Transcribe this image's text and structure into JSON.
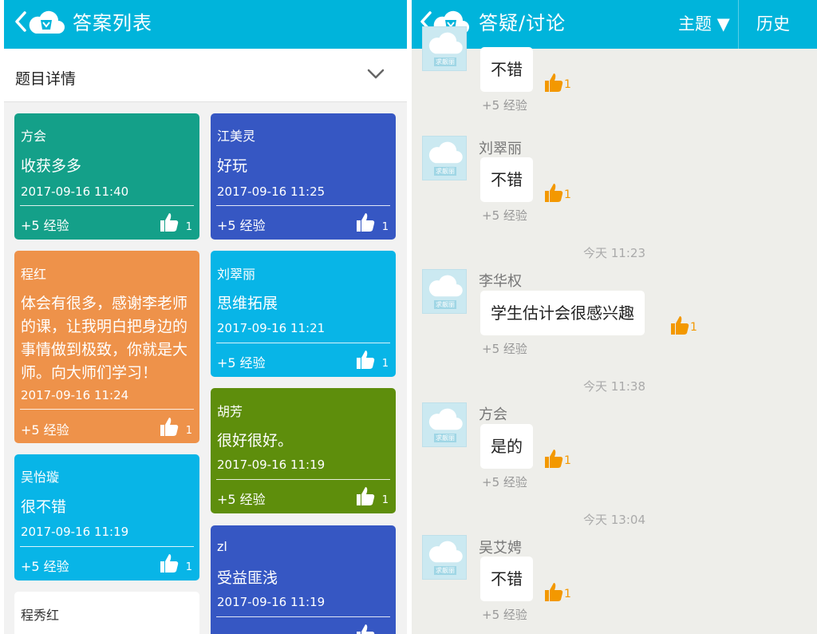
{
  "colors": {
    "header": "#00b4db",
    "accent_like": "#f39800"
  },
  "left_panel": {
    "title": "答案列表",
    "detail_label": "题目详情",
    "cards": [
      {
        "name": "方会",
        "content": "收获多多",
        "time": "2017-09-16 11:40",
        "exp": "+5 经验",
        "likes": "1",
        "color": "#14a089"
      },
      {
        "name": "程红",
        "content": "体会有很多，感谢李老师的课，让我明白把身边的事情做到极致，你就是大师。向大师们学习！",
        "time": "2017-09-16 11:24",
        "exp": "+5 经验",
        "likes": "1",
        "color": "#ee924a"
      },
      {
        "name": "吴怡璇",
        "content": "很不错",
        "time": "2017-09-16 11:19",
        "exp": "+5 经验",
        "likes": "1",
        "color": "#08b5e7"
      },
      {
        "name": "程秀红",
        "content": "",
        "time": "",
        "exp": "",
        "likes": "",
        "color": "#ffffff"
      },
      {
        "name": "江美灵",
        "content": "好玩",
        "time": "2017-09-16 11:25",
        "exp": "+5 经验",
        "likes": "1",
        "color": "#3657c3"
      },
      {
        "name": "刘翠丽",
        "content": "思维拓展",
        "time": "2017-09-16 11:21",
        "exp": "+5 经验",
        "likes": "1",
        "color": "#08b5e7"
      },
      {
        "name": "胡芳",
        "content": "很好很好。",
        "time": "2017-09-16 11:19",
        "exp": "+5 经验",
        "likes": "1",
        "color": "#5e8e0c"
      },
      {
        "name": "zl",
        "content": "受益匪浅",
        "time": "2017-09-16 11:19",
        "exp": "",
        "likes": "",
        "color": "#3657c3"
      }
    ]
  },
  "right_panel": {
    "title": "答疑/讨论",
    "menu_topic": "主题 ▼",
    "menu_history": "历史",
    "avatar_text": "求靓丽",
    "messages": [
      {
        "user": "",
        "text": "不错",
        "likes": "1",
        "exp": "+5 经验"
      },
      {
        "user": "刘翠丽",
        "text": "不错",
        "likes": "1",
        "exp": "+5 经验"
      },
      {
        "timestamp": "今天 11:23",
        "user": "李华权",
        "text": "学生估计会很感兴趣",
        "likes": "1",
        "exp": "+5 经验"
      },
      {
        "timestamp": "今天 11:38",
        "user": "方会",
        "text": "是的",
        "likes": "1",
        "exp": "+5 经验"
      },
      {
        "timestamp": "今天 13:04",
        "user": "吴艾娉",
        "text": "不错",
        "likes": "1",
        "exp": "+5 经验"
      }
    ]
  }
}
